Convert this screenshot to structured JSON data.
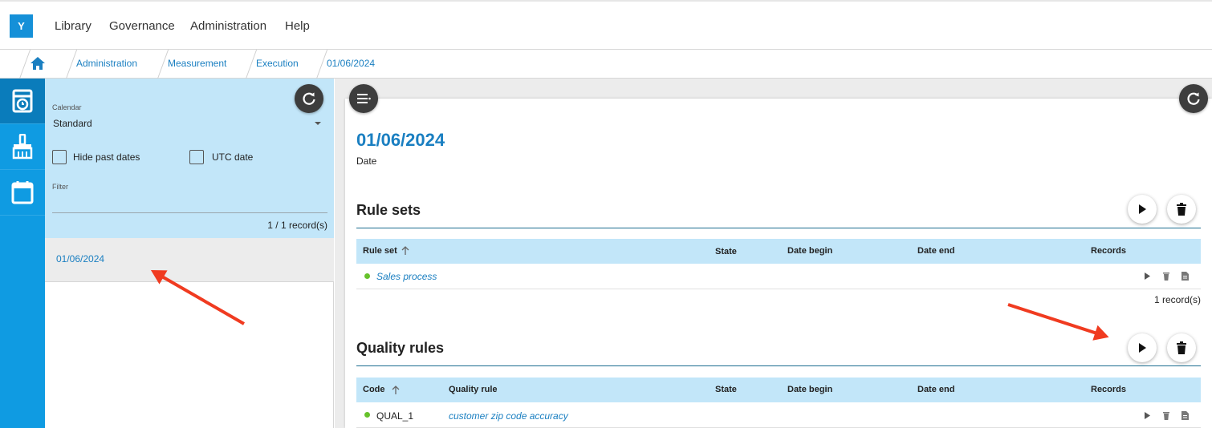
{
  "app": {
    "logo_letter": "Y"
  },
  "nav": {
    "items": [
      "Library",
      "Governance",
      "Administration",
      "Help"
    ]
  },
  "breadcrumb": [
    "Administration",
    "Measurement",
    "Execution",
    "01/06/2024"
  ],
  "rail": {
    "icons": [
      "scheduler-icon",
      "broom-icon",
      "calendar-icon"
    ]
  },
  "filters": {
    "calendar_label": "Calendar",
    "calendar_value": "Standard",
    "hide_past_label": "Hide past dates",
    "utc_label": "UTC date",
    "filter_label": "Filter",
    "record_count": "1 / 1 record(s)"
  },
  "list": {
    "items": [
      "01/06/2024"
    ]
  },
  "detail": {
    "title": "01/06/2024",
    "subtitle": "Date",
    "rule_sets": {
      "heading": "Rule sets",
      "columns": [
        "Rule set",
        "State",
        "Date begin",
        "Date end",
        "Records"
      ],
      "rows": [
        {
          "name": "Sales process",
          "status_color": "#66c22b"
        }
      ],
      "records": "1 record(s)"
    },
    "quality_rules": {
      "heading": "Quality rules",
      "columns": [
        "Code",
        "Quality rule",
        "State",
        "Date begin",
        "Date end",
        "Records"
      ],
      "rows": [
        {
          "code": "QUAL_1",
          "name": "customer zip code accuracy",
          "status_color": "#66c22b"
        }
      ]
    }
  },
  "colors": {
    "accent": "#1a7fc1",
    "rail": "#0f9be2",
    "header_bg": "#c2e6f9",
    "annotation": "#f03b20"
  }
}
